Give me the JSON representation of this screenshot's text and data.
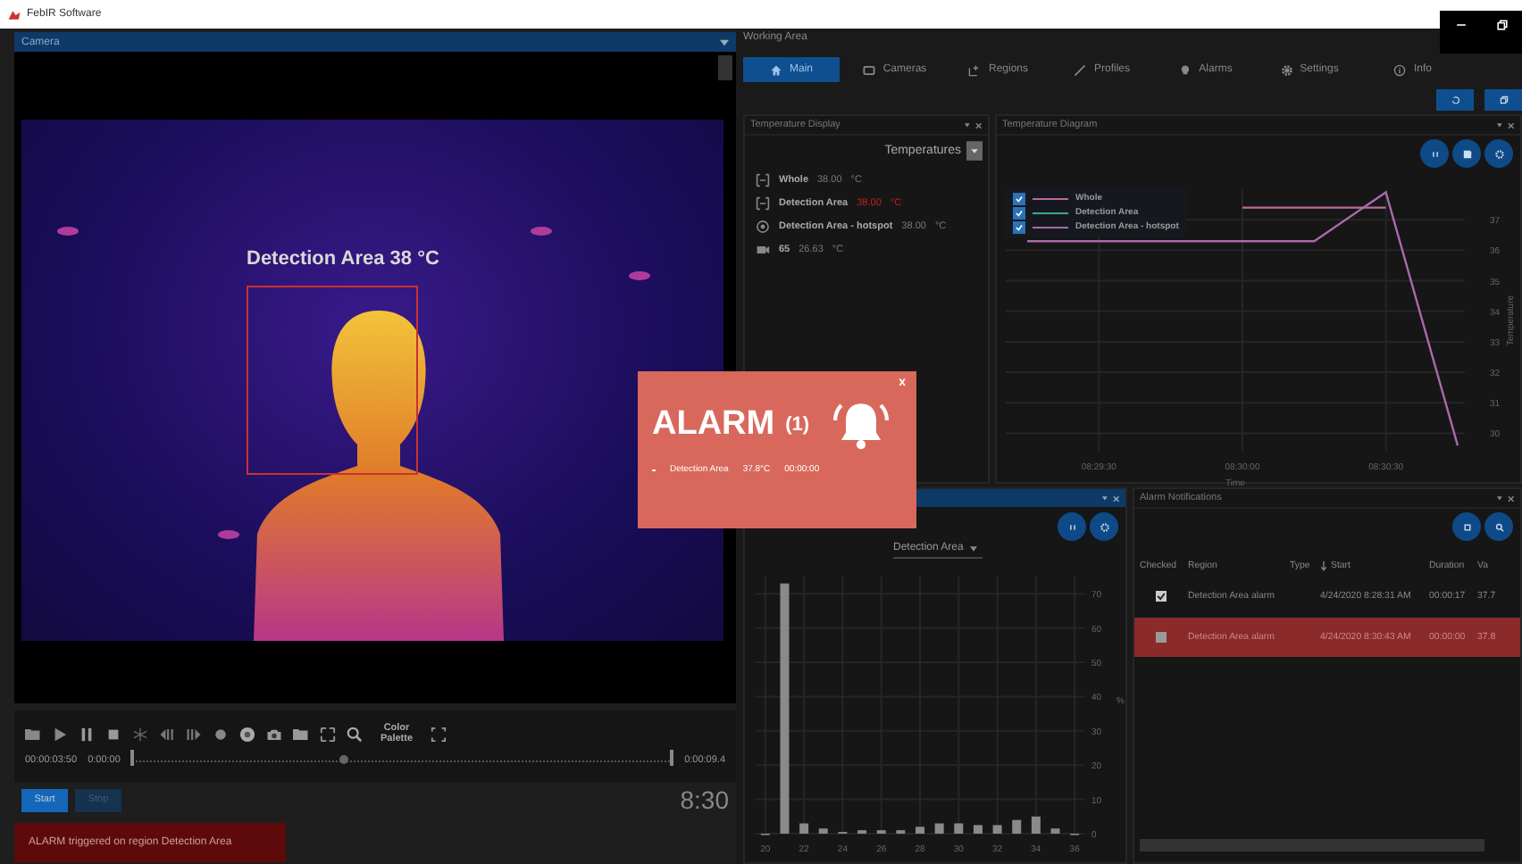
{
  "window": {
    "title": "FebIR Software"
  },
  "camera": {
    "title": "Camera",
    "overlay_label": "Detection Area  38 °C"
  },
  "playback": {
    "color_palette": "Color Palette",
    "elapsed": "00:00:03:50",
    "start_time": "0:00:00",
    "end_time": "0:00:09.4",
    "level": 0.39
  },
  "buttons": [
    {
      "label": "Start",
      "disabled": false
    },
    {
      "label": "Stop",
      "disabled": true
    }
  ],
  "clock": "8:30",
  "banner": "ALARM triggered on region Detection Area",
  "working_area": {
    "title": "Working Area",
    "tabs": [
      {
        "label": "Main",
        "selected": true
      },
      {
        "label": "Cameras",
        "selected": false
      },
      {
        "label": "Regions",
        "selected": false
      },
      {
        "label": "Profiles",
        "selected": false
      },
      {
        "label": "Alarms",
        "selected": false
      },
      {
        "label": "Settings",
        "selected": false
      },
      {
        "label": "Info",
        "selected": false
      }
    ]
  },
  "temperature_display": {
    "title": "Temperature Display",
    "dropdown": "Temperatures",
    "rows": [
      {
        "kind": "region",
        "name": "Whole",
        "value": "38.00",
        "unit": "°C",
        "alarm": false
      },
      {
        "kind": "region",
        "name": "Detection Area",
        "value": "38.00",
        "unit": "°C",
        "alarm": true
      },
      {
        "kind": "hotspot",
        "name": "Detection Area - hotspot",
        "value": "38.00",
        "unit": "°C",
        "alarm": false
      },
      {
        "kind": "camera",
        "name": "65",
        "value": "26.63",
        "unit": "°C",
        "alarm": false
      }
    ]
  },
  "temperature_diagram": {
    "title": "Temperature Diagram",
    "legend": [
      {
        "checked": true
      },
      {
        "checked": true
      },
      {
        "checked": true
      }
    ],
    "chart_data": {
      "type": "line",
      "xlabel": "Time",
      "ylabel": "Temperature",
      "categories": [
        null,
        "08:29:30",
        null,
        "08:30:00",
        null,
        "08:30:30",
        null
      ],
      "ylim": [
        29.4,
        38
      ],
      "grid": true,
      "legend": "upper left",
      "yticks": [
        30,
        31,
        32,
        33,
        34,
        35,
        36,
        37
      ],
      "series": [
        {
          "name": "Whole",
          "color": "#c06a9a",
          "values": [
            null,
            null,
            null,
            37.4,
            37.4,
            37.4,
            null
          ]
        },
        {
          "name": "Detection Area",
          "color": "#3aa890",
          "values": [
            null,
            null,
            null,
            null,
            null,
            null,
            null
          ]
        },
        {
          "name": "Detection Area - hotspot",
          "color": "#a86aa8",
          "values": [
            36.3,
            36.3,
            36.3,
            36.3,
            36.3,
            37.9,
            29.6
          ]
        }
      ]
    }
  },
  "histogram": {
    "dropdown": "Detection Area",
    "chart_data": {
      "type": "bar",
      "ylabel": "%",
      "categories": [
        "20",
        null,
        "22",
        null,
        "24",
        null,
        "26",
        null,
        "28",
        null,
        "30",
        null,
        "32",
        null,
        "34",
        null,
        "36"
      ],
      "grid": true,
      "values": [
        0,
        73,
        3,
        1.5,
        0.5,
        1,
        1,
        1,
        2,
        3,
        3,
        2.5,
        2.5,
        4,
        5,
        1.5,
        0
      ],
      "yticks": [
        0,
        10,
        20,
        30,
        40,
        50,
        60,
        70
      ],
      "ylim": [
        0,
        75
      ]
    }
  },
  "alarm_notifications": {
    "title": "Alarm Notifications",
    "columns": [
      "Checked",
      "Region",
      "Type",
      "Start",
      "Duration",
      "Va"
    ],
    "rows": [
      {
        "checked": true,
        "selected": false,
        "region": "Detection Area alarm",
        "start": "4/24/2020 8:28:31 AM",
        "duration": "00:00:17",
        "value": "37.7"
      },
      {
        "checked": false,
        "selected": true,
        "region": "Detection Area alarm",
        "start": "4/24/2020 8:30:43 AM",
        "duration": "00:00:00",
        "value": "37.8"
      }
    ]
  },
  "alarm_popup": {
    "title": "ALARM",
    "count": "(1)",
    "close": "x",
    "entries": [
      {
        "region": "Detection Area",
        "temperature": "37.8°C",
        "duration": "00:00:00"
      }
    ]
  }
}
